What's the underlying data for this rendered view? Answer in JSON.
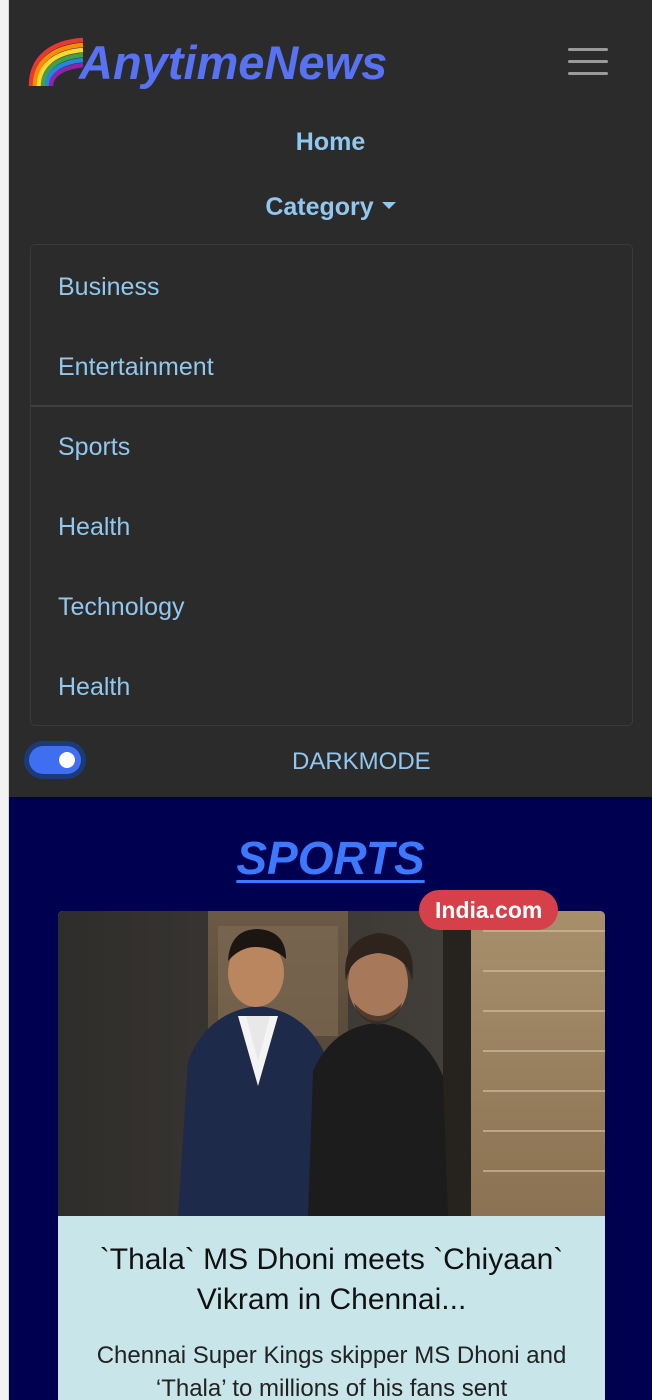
{
  "brand": {
    "name": "AnytimeNews",
    "icon": "rainbow-icon"
  },
  "nav": {
    "toggler_icon": "hamburger-icon",
    "home_label": "Home",
    "category_label": "Category",
    "category_items": [
      "Business",
      "Entertainment",
      "Sports",
      "Health",
      "Technology",
      "Health"
    ]
  },
  "darkmode": {
    "label": "DARKMODE",
    "enabled": true
  },
  "section": {
    "title": "SPORTS"
  },
  "article": {
    "source": "India.com",
    "title": "`Thala` MS Dhoni meets `Chiyaan` Vikram in Chennai...",
    "description": "Chennai Super Kings skipper MS Dhoni and ‘Thala’ to millions of his fans sent"
  },
  "colors": {
    "navbar_bg": "#2b2b2b",
    "brand": "#5772f2",
    "nav_link": "#91c8ef",
    "content_bg": "#000050",
    "section_title": "#3c79ff",
    "card_body": "#c8e6ea",
    "badge": "#d6404a",
    "switch_on": "#3f6ff0"
  }
}
